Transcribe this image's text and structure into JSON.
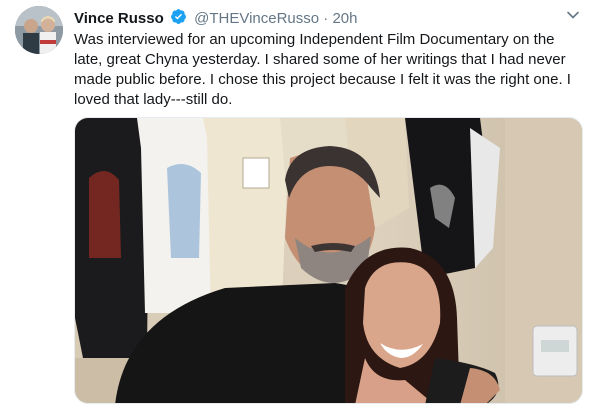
{
  "tweet": {
    "name": "Vince Russo",
    "handle": "@THEVinceRusso",
    "separator": "·",
    "time": "20h",
    "text_lines": [
      "Was interviewed for an upcoming Independent Film Documentary on the",
      "late, great Chyna yesterday. I shared some of her writings that I had never",
      "made public before. I chose this project because I felt it was the right one. I",
      "loved that lady---still do."
    ],
    "verified_icon": "verified-badge-icon",
    "menu_icon": "chevron-down-icon"
  },
  "colors": {
    "name": "#14171a",
    "secondary": "#657786",
    "verified": "#1da1f2"
  }
}
